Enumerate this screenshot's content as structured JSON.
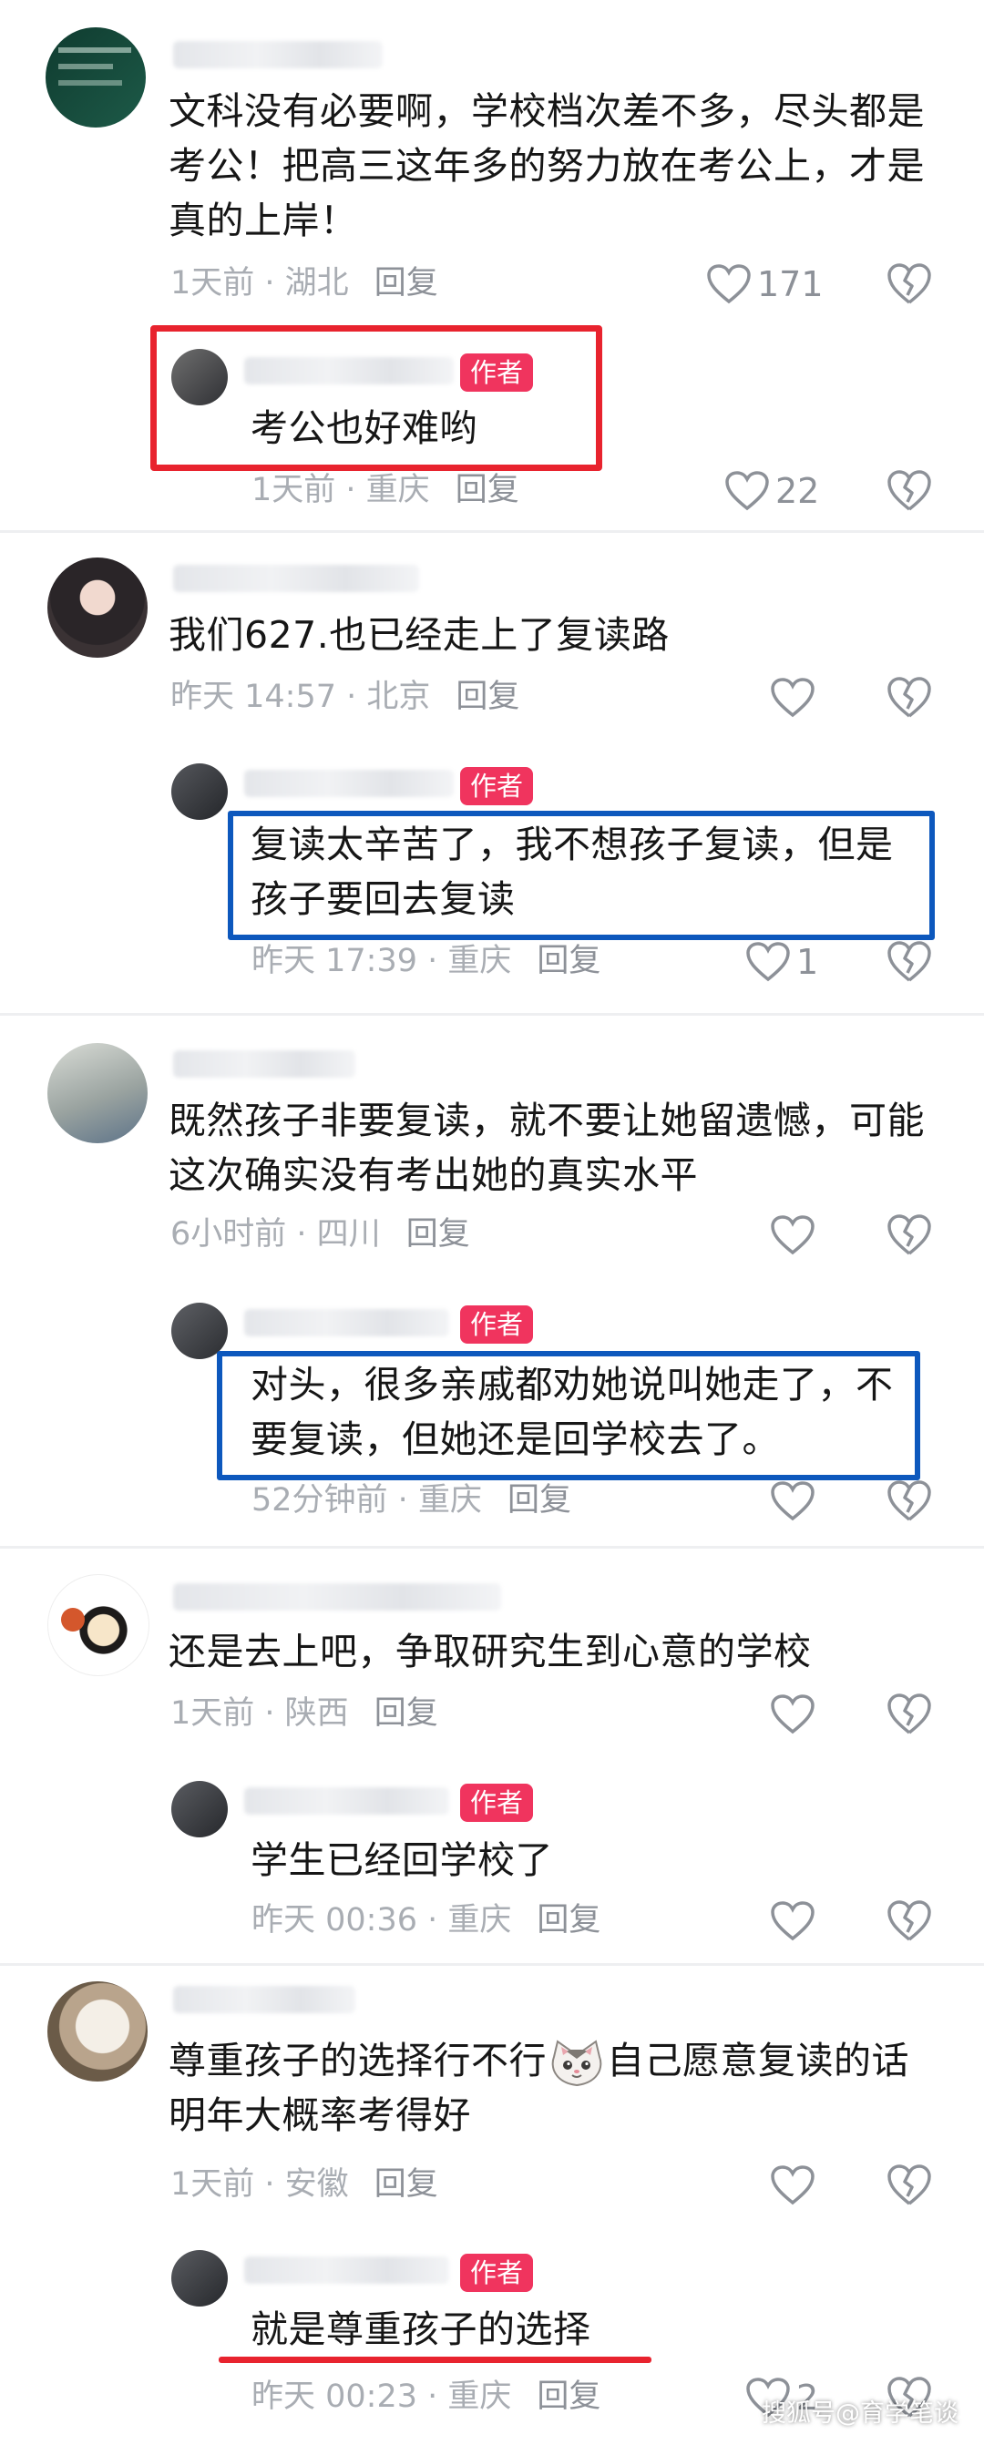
{
  "author_badge": "作者",
  "reply_label": "回复",
  "comments": [
    {
      "text": "文科没有必要啊，学校档次差不多，尽头都是考公！把高三这年多的努力放在考公上，才是真的上岸！",
      "time": "1天前",
      "location": "湖北",
      "likes": "171",
      "reply": {
        "text": "考公也好难哟",
        "time": "1天前",
        "location": "重庆",
        "likes": "22",
        "highlight": "red-box"
      }
    },
    {
      "text": "我们627.也已经走上了复读路",
      "time": "昨天 14:57",
      "location": "北京",
      "likes": "",
      "reply": {
        "text": "复读太辛苦了，我不想孩子复读，但是孩子要回去复读",
        "time": "昨天 17:39",
        "location": "重庆",
        "likes": "1",
        "highlight": "blue-box"
      }
    },
    {
      "text": "既然孩子非要复读，就不要让她留遗憾，可能这次确实没有考出她的真实水平",
      "time": "6小时前",
      "location": "四川",
      "likes": "",
      "reply": {
        "text": "对头，很多亲戚都劝她说叫她走了，不要复读，但她还是回学校去了。",
        "time": "52分钟前",
        "location": "重庆",
        "likes": "",
        "highlight": "blue-box"
      }
    },
    {
      "text": "还是去上吧，争取研究生到心意的学校",
      "time": "1天前",
      "location": "陕西",
      "likes": "",
      "reply": {
        "text": "学生已经回学校了",
        "time": "昨天 00:36",
        "location": "重庆",
        "likes": "",
        "highlight": "none"
      }
    },
    {
      "text_part1": "尊重孩子的选择行不行",
      "text_part2": "自己愿意复读的话明年大概率考得好",
      "emoji": "cat-face-emoji",
      "time": "1天前",
      "location": "安徽",
      "likes": "",
      "reply": {
        "text": "就是尊重孩子的选择",
        "time": "昨天 00:23",
        "location": "重庆",
        "likes": "2",
        "highlight": "red-underline"
      }
    }
  ],
  "watermark": "搜狐号@育学笔谈",
  "colors": {
    "badge": "#f0345e",
    "red_highlight": "#e8232e",
    "blue_highlight": "#0d58bd",
    "meta_text": "#a9adb3"
  }
}
